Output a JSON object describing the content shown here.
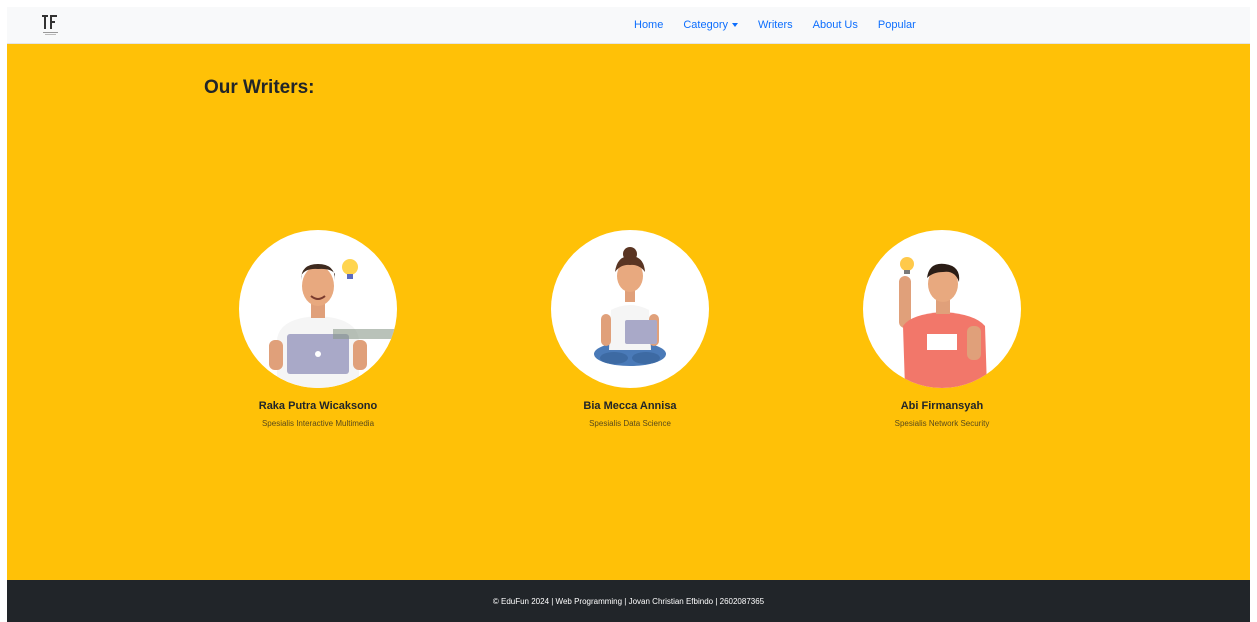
{
  "navbar": {
    "logo_text": "IF",
    "links": [
      "Home",
      "Category",
      "Writers",
      "About Us",
      "Popular"
    ]
  },
  "main": {
    "title": "Our Writers:",
    "writers": [
      {
        "name": "Raka Putra Wicaksono",
        "role": "Spesialis Interactive Multimedia",
        "icon": "man-with-laptop-lightbulb"
      },
      {
        "name": "Bia Mecca Annisa",
        "role": "Spesialis Data Science",
        "icon": "woman-sitting-with-laptop"
      },
      {
        "name": "Abi Firmansyah",
        "role": "Spesialis Network Security",
        "icon": "man-with-idea-lightbulb"
      }
    ]
  },
  "footer": {
    "text": "© EduFun 2024 | Web Programming | Jovan Christian Efbindo | 2602087365"
  },
  "colors": {
    "accent": "#ffc107",
    "nav_link": "#0d6efd",
    "footer_bg": "#212529",
    "navbar_bg": "#f8f9fa"
  }
}
